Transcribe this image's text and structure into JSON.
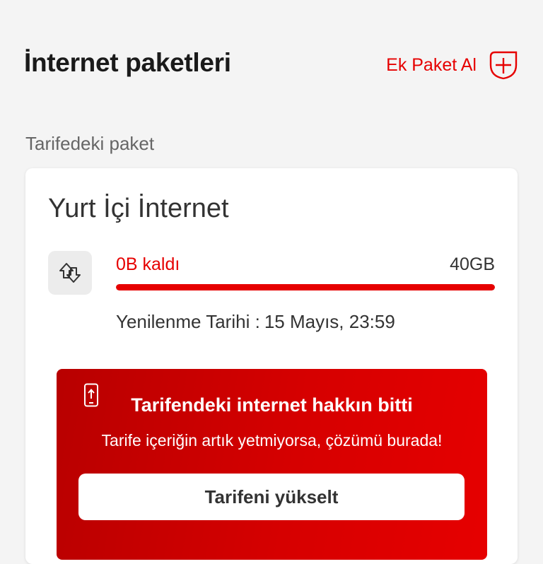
{
  "header": {
    "title": "İnternet paketleri",
    "add_package_label": "Ek Paket Al",
    "add_package_icon": "plus-shield-icon"
  },
  "section_label": "Tarifedeki paket",
  "package_card": {
    "title": "Yurt İçi İnternet",
    "icon": "data-arrows-icon",
    "remaining_label": "0B kaldı",
    "total_label": "40GB",
    "usage_fraction": 1.0,
    "renewal_label": "Yenilenme Tarihi :",
    "renewal_value": "15 Mayıs, 23:59"
  },
  "promo": {
    "icon": "phone-upload-icon",
    "title": "Tarifendeki internet hakkın bitti",
    "text": "Tarife içeriğin artık yetmiyorsa, çözümü burada!",
    "button_label": "Tarifeni yükselt"
  },
  "colors": {
    "accent": "#e60000",
    "background": "#f4f4f4",
    "card": "#ffffff"
  }
}
